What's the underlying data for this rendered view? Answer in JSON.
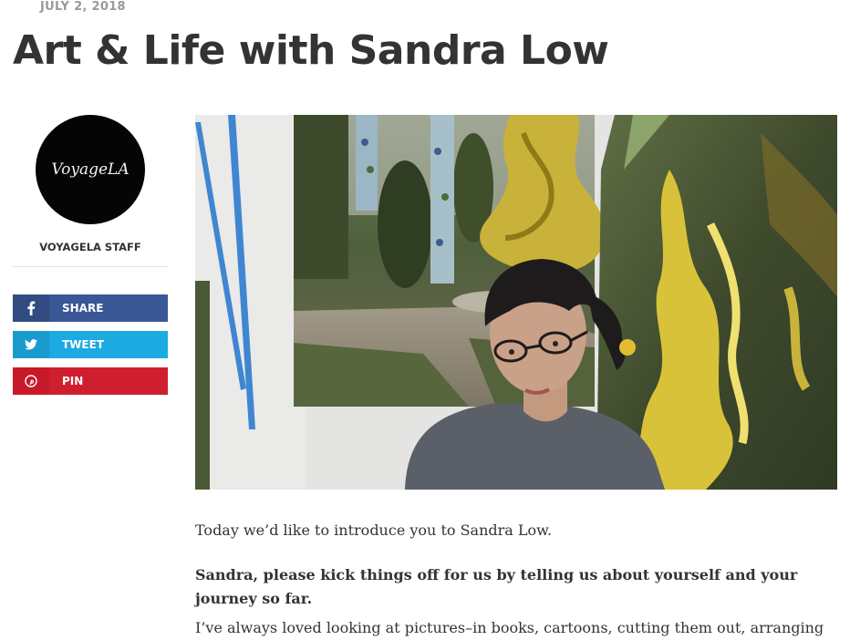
{
  "post": {
    "date": "JULY 2, 2018",
    "title": "Art & Life with Sandra Low"
  },
  "author": {
    "avatar_text": "VoyageLA",
    "name": "VOYAGELA STAFF"
  },
  "share": {
    "facebook": {
      "label": "SHARE",
      "icon": "facebook-icon",
      "color": "#3a5795"
    },
    "twitter": {
      "label": "TWEET",
      "icon": "twitter-icon",
      "color": "#1caae2"
    },
    "pinterest": {
      "label": "PIN",
      "icon": "pinterest-icon",
      "color": "#cf1f2e"
    }
  },
  "article": {
    "intro": "Today we’d like to introduce you to Sandra Low.",
    "question": "Sandra, please kick things off for us by telling us about yourself and your journey so far.",
    "answer": "I’ve always loved looking at pictures–in books, cartoons, cutting them out, arranging"
  }
}
